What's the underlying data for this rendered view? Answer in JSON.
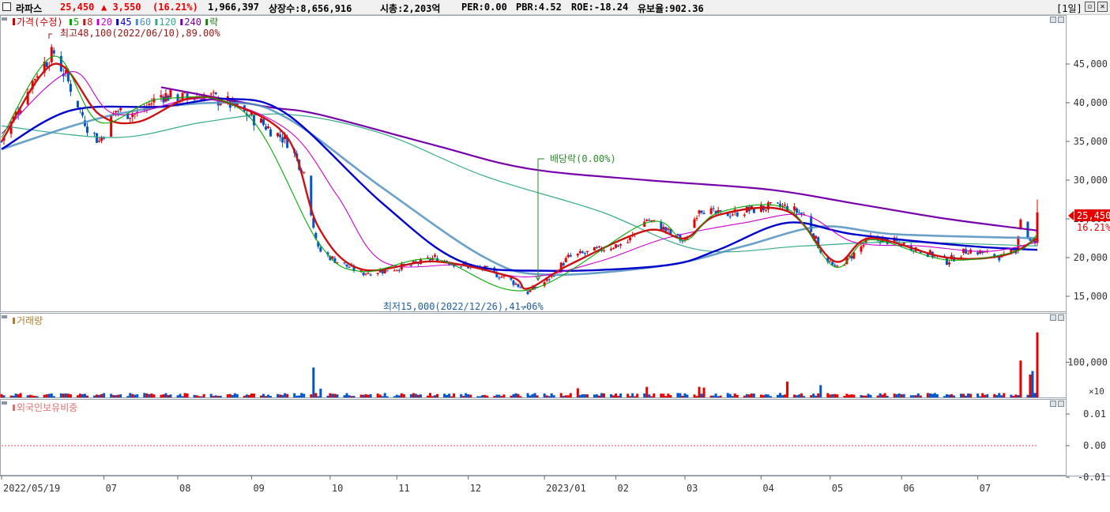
{
  "header": {
    "stock_name": "라파스",
    "price": "25,450",
    "change": "▲ 3,550",
    "change_pct": "(16.21%)",
    "volume": "1,966,397",
    "listed": "상장수:8,656,916",
    "mcap": "시총:2,203억",
    "per": "PER:0.00",
    "pbr": "PBR:4.52",
    "roe": "ROE:-18.24",
    "retention": "유보율:902.36",
    "period": "[1일]"
  },
  "colors": {
    "up": "#e60000",
    "down": "#0055cc",
    "ma5": "#00aa00",
    "ma8": "#cc1111",
    "ma20": "#cc00cc",
    "ma45": "#0000cc",
    "ma60": "#5090c0",
    "ma120": "#33aa88",
    "ma240": "#7700aa"
  },
  "legend": {
    "price": "가격(수정)",
    "ma": [
      {
        "label": "5",
        "color": "#00aa00"
      },
      {
        "label": "8",
        "color": "#cc1111"
      },
      {
        "label": "20",
        "color": "#cc00cc"
      },
      {
        "label": "45",
        "color": "#0000cc"
      },
      {
        "label": "60",
        "color": "#5090c0"
      },
      {
        "label": "120",
        "color": "#33aa88"
      },
      {
        "label": "240",
        "color": "#7700aa"
      }
    ],
    "drop": "락"
  },
  "annotations": {
    "high": "최고48,100(2022/06/10),89.00%",
    "low": "최저15,000(2022/12/26),41.06%",
    "dividend": "배당락(0.00%)"
  },
  "price_tag": {
    "value": "25,450",
    "pct": "16.21%"
  },
  "volume_panel": {
    "title": "거래량",
    "multiplier": "×10"
  },
  "foreign_panel": {
    "title": "외국인보유비중"
  },
  "chart_data": [
    {
      "type": "candlestick",
      "title": "가격(수정)",
      "ylim": [
        14000,
        49000
      ],
      "yticks": [
        15000,
        20000,
        25000,
        30000,
        35000,
        40000,
        45000
      ],
      "ytick_labels": [
        "15,000",
        "20,000",
        "25,000",
        "30,000",
        "35,000",
        "40,000",
        "45,000"
      ],
      "x_axis_labels": [
        "2022/05/19",
        "07",
        "08",
        "09",
        "10",
        "11",
        "12",
        "2023/01",
        "02",
        "03",
        "04",
        "05",
        "06",
        "07"
      ],
      "close_anchors": [
        {
          "d": "2022/05/19",
          "v": 35000
        },
        {
          "d": "2022/05/25",
          "v": 38500
        },
        {
          "d": "2022/06/03",
          "v": 44000
        },
        {
          "d": "2022/06/10",
          "v": 46500
        },
        {
          "d": "2022/06/17",
          "v": 42000
        },
        {
          "d": "2022/06/24",
          "v": 37000
        },
        {
          "d": "2022/06/29",
          "v": 35000
        },
        {
          "d": "2022/07/06",
          "v": 39000
        },
        {
          "d": "2022/07/15",
          "v": 38500
        },
        {
          "d": "2022/07/25",
          "v": 41000
        },
        {
          "d": "2022/08/05",
          "v": 40500
        },
        {
          "d": "2022/08/12",
          "v": 41000
        },
        {
          "d": "2022/08/22",
          "v": 40000
        },
        {
          "d": "2022/08/30",
          "v": 38500
        },
        {
          "d": "2022/09/07",
          "v": 37000
        },
        {
          "d": "2022/09/16",
          "v": 35000
        },
        {
          "d": "2022/09/23",
          "v": 31000
        },
        {
          "d": "2022/09/29",
          "v": 21000
        },
        {
          "d": "2022/10/07",
          "v": 19500
        },
        {
          "d": "2022/10/17",
          "v": 18000
        },
        {
          "d": "2022/10/26",
          "v": 18300
        },
        {
          "d": "2022/11/07",
          "v": 19000
        },
        {
          "d": "2022/11/17",
          "v": 20000
        },
        {
          "d": "2022/11/28",
          "v": 19000
        },
        {
          "d": "2022/12/08",
          "v": 18500
        },
        {
          "d": "2022/12/19",
          "v": 17000
        },
        {
          "d": "2022/12/26",
          "v": 15500
        },
        {
          "d": "2023/01/03",
          "v": 17000
        },
        {
          "d": "2023/01/12",
          "v": 20000
        },
        {
          "d": "2023/01/25",
          "v": 21000
        },
        {
          "d": "2023/02/06",
          "v": 22000
        },
        {
          "d": "2023/02/14",
          "v": 25000
        },
        {
          "d": "2023/02/22",
          "v": 23500
        },
        {
          "d": "2023/03/02",
          "v": 22000
        },
        {
          "d": "2023/03/08",
          "v": 26500
        },
        {
          "d": "2023/03/16",
          "v": 25500
        },
        {
          "d": "2023/03/27",
          "v": 26000
        },
        {
          "d": "2023/04/06",
          "v": 26500
        },
        {
          "d": "2023/04/14",
          "v": 26500
        },
        {
          "d": "2023/04/21",
          "v": 25500
        },
        {
          "d": "2023/04/28",
          "v": 21000
        },
        {
          "d": "2023/05/04",
          "v": 18500
        },
        {
          "d": "2023/05/12",
          "v": 20500
        },
        {
          "d": "2023/05/19",
          "v": 22500
        },
        {
          "d": "2023/05/30",
          "v": 22000
        },
        {
          "d": "2023/06/09",
          "v": 21000
        },
        {
          "d": "2023/06/20",
          "v": 19500
        },
        {
          "d": "2023/06/29",
          "v": 21000
        },
        {
          "d": "2023/07/07",
          "v": 20500
        },
        {
          "d": "2023/07/14",
          "v": 20000
        },
        {
          "d": "2023/07/19",
          "v": 21000
        },
        {
          "d": "2023/07/21",
          "v": 25000
        },
        {
          "d": "2023/07/25",
          "v": 22000
        },
        {
          "d": "2023/07/27",
          "v": 21900
        },
        {
          "d": "2023/07/28",
          "v": 25450
        }
      ],
      "moving_averages": [
        {
          "name": "240",
          "color": "#7700aa",
          "values": [
            {
              "d": "2022/07/25",
              "v": 42000
            },
            {
              "d": "2022/09/07",
              "v": 39500
            },
            {
              "d": "2022/09/29",
              "v": 38500
            },
            {
              "d": "2022/11/17",
              "v": 34500
            },
            {
              "d": "2022/12/26",
              "v": 31500
            },
            {
              "d": "2023/02/14",
              "v": 30000
            },
            {
              "d": "2023/04/06",
              "v": 28800
            },
            {
              "d": "2023/05/12",
              "v": 27000
            },
            {
              "d": "2023/06/20",
              "v": 25000
            },
            {
              "d": "2023/07/28",
              "v": 23500
            }
          ]
        },
        {
          "name": "120",
          "color": "#33aa88",
          "values": [
            {
              "d": "2022/05/19",
              "v": 37000
            },
            {
              "d": "2022/07/06",
              "v": 35500
            },
            {
              "d": "2022/08/12",
              "v": 37500
            },
            {
              "d": "2022/09/16",
              "v": 38500
            },
            {
              "d": "2022/10/26",
              "v": 36000
            },
            {
              "d": "2022/12/08",
              "v": 30500
            },
            {
              "d": "2023/01/25",
              "v": 26000
            },
            {
              "d": "2023/03/08",
              "v": 21000
            },
            {
              "d": "2023/04/21",
              "v": 21500
            },
            {
              "d": "2023/05/30",
              "v": 22000
            },
            {
              "d": "2023/07/28",
              "v": 21500
            }
          ]
        },
        {
          "name": "60",
          "color": "#5090c0",
          "values": [
            {
              "d": "2022/05/19",
              "v": 34000
            },
            {
              "d": "2022/07/06",
              "v": 38500
            },
            {
              "d": "2022/08/22",
              "v": 40000
            },
            {
              "d": "2022/09/16",
              "v": 38000
            },
            {
              "d": "2022/10/26",
              "v": 29000
            },
            {
              "d": "2022/12/08",
              "v": 20000
            },
            {
              "d": "2023/01/03",
              "v": 17800
            },
            {
              "d": "2023/02/22",
              "v": 19000
            },
            {
              "d": "2023/03/27",
              "v": 21500
            },
            {
              "d": "2023/04/28",
              "v": 24000
            },
            {
              "d": "2023/05/30",
              "v": 23000
            },
            {
              "d": "2023/07/28",
              "v": 22500
            }
          ]
        },
        {
          "name": "45",
          "color": "#0000cc",
          "values": [
            {
              "d": "2022/05/19",
              "v": 34000
            },
            {
              "d": "2022/06/17",
              "v": 39000
            },
            {
              "d": "2022/07/25",
              "v": 39500
            },
            {
              "d": "2022/08/22",
              "v": 40500
            },
            {
              "d": "2022/09/16",
              "v": 38500
            },
            {
              "d": "2022/10/26",
              "v": 27000
            },
            {
              "d": "2022/11/28",
              "v": 19500
            },
            {
              "d": "2023/01/03",
              "v": 18300
            },
            {
              "d": "2023/02/22",
              "v": 19000
            },
            {
              "d": "2023/03/16",
              "v": 21000
            },
            {
              "d": "2023/04/14",
              "v": 24500
            },
            {
              "d": "2023/05/12",
              "v": 23000
            },
            {
              "d": "2023/06/29",
              "v": 21500
            },
            {
              "d": "2023/07/28",
              "v": 21000
            }
          ]
        },
        {
          "name": "20",
          "color": "#cc00cc",
          "values": [
            {
              "d": "2022/05/19",
              "v": 36000
            },
            {
              "d": "2022/06/17",
              "v": 44000
            },
            {
              "d": "2022/07/06",
              "v": 38500
            },
            {
              "d": "2022/08/12",
              "v": 40500
            },
            {
              "d": "2022/09/16",
              "v": 36500
            },
            {
              "d": "2022/10/07",
              "v": 28000
            },
            {
              "d": "2022/10/26",
              "v": 19500
            },
            {
              "d": "2022/11/28",
              "v": 19000
            },
            {
              "d": "2022/12/26",
              "v": 17500
            },
            {
              "d": "2023/01/25",
              "v": 19500
            },
            {
              "d": "2023/02/22",
              "v": 22500
            },
            {
              "d": "2023/03/27",
              "v": 24500
            },
            {
              "d": "2023/04/21",
              "v": 25500
            },
            {
              "d": "2023/05/12",
              "v": 22000
            },
            {
              "d": "2023/06/09",
              "v": 21500
            },
            {
              "d": "2023/07/07",
              "v": 20800
            },
            {
              "d": "2023/07/28",
              "v": 22000
            }
          ]
        },
        {
          "name": "8",
          "color": "#cc1111",
          "values": [
            {
              "d": "2022/05/19",
              "v": 35000
            },
            {
              "d": "2022/06/10",
              "v": 45000
            },
            {
              "d": "2022/06/29",
              "v": 38500
            },
            {
              "d": "2022/07/15",
              "v": 37500
            },
            {
              "d": "2022/08/05",
              "v": 40500
            },
            {
              "d": "2022/08/22",
              "v": 40000
            },
            {
              "d": "2022/09/16",
              "v": 35500
            },
            {
              "d": "2022/09/29",
              "v": 24000
            },
            {
              "d": "2022/10/17",
              "v": 18500
            },
            {
              "d": "2022/11/17",
              "v": 19500
            },
            {
              "d": "2022/12/19",
              "v": 17500
            },
            {
              "d": "2022/12/26",
              "v": 16000
            },
            {
              "d": "2023/01/12",
              "v": 19000
            },
            {
              "d": "2023/02/14",
              "v": 23500
            },
            {
              "d": "2023/03/02",
              "v": 22500
            },
            {
              "d": "2023/03/16",
              "v": 25500
            },
            {
              "d": "2023/04/14",
              "v": 26000
            },
            {
              "d": "2023/05/04",
              "v": 19500
            },
            {
              "d": "2023/05/19",
              "v": 22500
            },
            {
              "d": "2023/06/20",
              "v": 20000
            },
            {
              "d": "2023/07/14",
              "v": 20300
            },
            {
              "d": "2023/07/28",
              "v": 22500
            }
          ]
        },
        {
          "name": "5",
          "color": "#00aa00",
          "values": [
            {
              "d": "2022/05/19",
              "v": 35500
            },
            {
              "d": "2022/06/10",
              "v": 46000
            },
            {
              "d": "2022/06/29",
              "v": 37500
            },
            {
              "d": "2022/07/25",
              "v": 40500
            },
            {
              "d": "2022/08/30",
              "v": 38500
            },
            {
              "d": "2022/09/29",
              "v": 22000
            },
            {
              "d": "2022/10/17",
              "v": 18200
            },
            {
              "d": "2022/11/17",
              "v": 19800
            },
            {
              "d": "2022/12/26",
              "v": 15800
            },
            {
              "d": "2023/02/14",
              "v": 24500
            },
            {
              "d": "2023/03/02",
              "v": 22200
            },
            {
              "d": "2023/03/16",
              "v": 25800
            },
            {
              "d": "2023/04/14",
              "v": 26300
            },
            {
              "d": "2023/05/04",
              "v": 18800
            },
            {
              "d": "2023/05/19",
              "v": 22300
            },
            {
              "d": "2023/06/20",
              "v": 19700
            },
            {
              "d": "2023/07/19",
              "v": 20800
            },
            {
              "d": "2023/07/28",
              "v": 23000
            }
          ]
        }
      ]
    },
    {
      "type": "bar",
      "title": "거래량",
      "ylim": [
        0,
        200000
      ],
      "yticks": [
        100000
      ],
      "ytick_labels": [
        "100,000"
      ],
      "spikes": [
        {
          "d": "2022/09/27",
          "v": 85000,
          "dir": "down"
        },
        {
          "d": "2022/09/30",
          "v": 25000,
          "dir": "down"
        },
        {
          "d": "2023/01/16",
          "v": 26000,
          "dir": "up"
        },
        {
          "d": "2023/02/14",
          "v": 30000,
          "dir": "up"
        },
        {
          "d": "2023/03/08",
          "v": 30000,
          "dir": "up"
        },
        {
          "d": "2023/03/10",
          "v": 28000,
          "dir": "up"
        },
        {
          "d": "2023/04/14",
          "v": 45000,
          "dir": "up"
        },
        {
          "d": "2023/04/28",
          "v": 35000,
          "dir": "down"
        },
        {
          "d": "2023/07/21",
          "v": 105000,
          "dir": "up"
        },
        {
          "d": "2023/07/25",
          "v": 65000,
          "dir": "up"
        },
        {
          "d": "2023/07/26",
          "v": 75000,
          "dir": "down"
        },
        {
          "d": "2023/07/28",
          "v": 185000,
          "dir": "up"
        }
      ],
      "base_volume": 8000
    },
    {
      "type": "line",
      "title": "외국인보유비중",
      "ylim": [
        -0.01,
        0.01
      ],
      "yticks": [
        -0.01,
        0.0,
        0.01
      ],
      "ytick_labels": [
        "-0.01",
        "0.00",
        "0.01"
      ],
      "values": [
        {
          "d": "2022/05/19",
          "v": 0.0
        },
        {
          "d": "2023/07/28",
          "v": 0.0
        }
      ]
    }
  ]
}
